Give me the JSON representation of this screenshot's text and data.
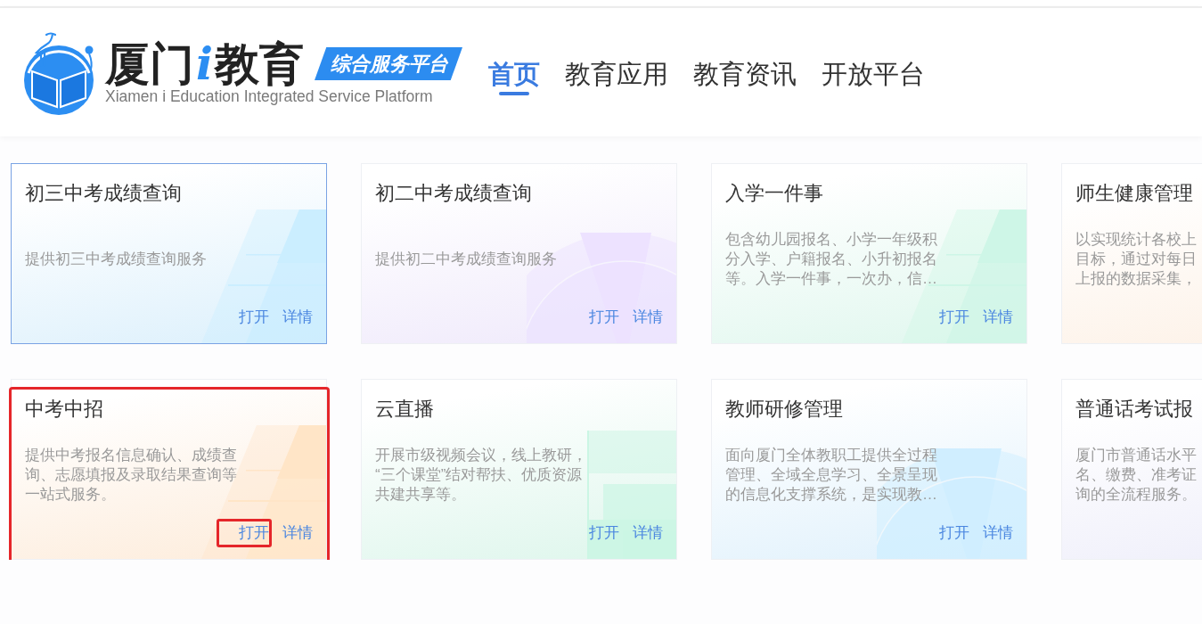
{
  "header": {
    "logo": {
      "name_parts": [
        {
          "text": "厦门",
          "kind": "plain"
        },
        {
          "text": "i",
          "kind": "accent"
        },
        {
          "text": "教育",
          "kind": "plain"
        }
      ],
      "tag": "综合服务平台",
      "subtitle": "Xiamen i Education Integrated Service Platform"
    },
    "nav": [
      {
        "label": "首页",
        "selected": true
      },
      {
        "label": "教育应用",
        "selected": false
      },
      {
        "label": "教育资讯",
        "selected": false
      },
      {
        "label": "开放平台",
        "selected": false
      }
    ]
  },
  "cards": [
    {
      "title": "初三中考成绩查询",
      "description_lines": [
        "提供初三中考成绩查询服务"
      ],
      "selected": true,
      "highlighted": false,
      "color": "#dcf0fc",
      "kind": "stripes",
      "actions": [
        {
          "label": "打开",
          "highlighted": false
        },
        {
          "label": "详情",
          "highlighted": false
        }
      ]
    },
    {
      "title": "初二中考成绩查询",
      "description_lines": [
        "提供初二中考成绩查询服务"
      ],
      "selected": false,
      "highlighted": false,
      "color": "#efe9fb",
      "kind": "arc",
      "actions": [
        {
          "label": "打开",
          "highlighted": false
        },
        {
          "label": "详情",
          "highlighted": false
        }
      ]
    },
    {
      "title": "入学一件事",
      "description_lines": [
        "包含幼儿园报名、小学一年级积",
        "分入学、户籍报名、小升初报名",
        "等。入学一件事，一次办，信…"
      ],
      "selected": false,
      "highlighted": false,
      "color": "#e0f7ee",
      "kind": "stripes",
      "actions": [
        {
          "label": "打开",
          "highlighted": false
        },
        {
          "label": "详情",
          "highlighted": false
        }
      ]
    },
    {
      "title": "师生健康管理",
      "description_lines": [
        "以实现统计各校上",
        "目标，通过对每日",
        "上报的数据采集，"
      ],
      "selected": false,
      "highlighted": false,
      "color": "#fdf1e6"
    },
    {
      "title": "中考中招",
      "description_lines": [
        "提供中考报名信息确认、成绩查",
        "询、志愿填报及录取结果查询等",
        "一站式服务。"
      ],
      "selected": false,
      "highlighted": true,
      "color": "#fdecdb",
      "kind": "stripes",
      "actions": [
        {
          "label": "打开",
          "highlighted": true
        },
        {
          "label": "详情",
          "highlighted": false
        }
      ]
    },
    {
      "title": "云直播",
      "description_lines": [
        "开展市级视频会议，线上教研，",
        "“三个课堂”结对帮扶、优质资源",
        "共建共享等。"
      ],
      "selected": false,
      "highlighted": false,
      "color": "#def6ec",
      "kind": "tiles",
      "actions": [
        {
          "label": "打开",
          "highlighted": false
        },
        {
          "label": "详情",
          "highlighted": false
        }
      ]
    },
    {
      "title": "教师研修管理",
      "description_lines": [
        "面向厦门全体教职工提供全过程",
        "管理、全域全息学习、全景呈现",
        "的信息化支撑系统，是实现教…"
      ],
      "selected": false,
      "highlighted": false,
      "color": "#e0f1fc",
      "kind": "arc",
      "actions": [
        {
          "label": "打开",
          "highlighted": false
        },
        {
          "label": "详情",
          "highlighted": false
        }
      ]
    },
    {
      "title": "普通话考试报",
      "description_lines": [
        "厦门市普通话水平",
        "名、缴费、准考证",
        "询的全流程服务。"
      ],
      "selected": false,
      "highlighted": false,
      "color": "#eeeefa"
    }
  ]
}
